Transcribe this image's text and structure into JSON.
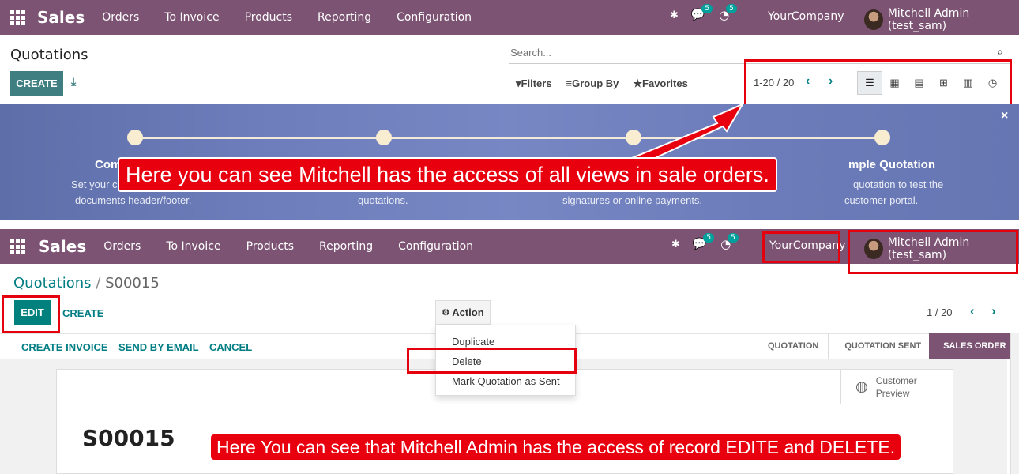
{
  "top_nav": {
    "brand": "Sales",
    "menu": [
      "Orders",
      "To Invoice",
      "Products",
      "Reporting",
      "Configuration"
    ],
    "chat_badge": "5",
    "activity_badge": "5",
    "company": "YourCompany",
    "user": "Mitchell Admin (test_sam)"
  },
  "list_view": {
    "title": "Quotations",
    "create_label": "CREATE",
    "search_placeholder": "Search...",
    "filters_label": "Filters",
    "group_by_label": "Group By",
    "favorites_label": "Favorites",
    "pager": "1-20 / 20",
    "view_icons": [
      "list-view-icon",
      "kanban-view-icon",
      "calendar-view-icon",
      "pivot-view-icon",
      "graph-view-icon",
      "activity-view-icon"
    ]
  },
  "banner": {
    "step1_title": "Com",
    "step1_text_a": "Set your c",
    "step1_text_b": "documents header/footer.",
    "step2_text": "quotations.",
    "step3_text": "signatures or online payments.",
    "step4_title": "mple Quotation",
    "step4_text_a": "quotation to test the",
    "step4_text_b": "customer portal.",
    "close": "×"
  },
  "callout_top": "Here you can see Mitchell has the access of all views in sale orders.",
  "form_view": {
    "breadcrumb_parent": "Quotations",
    "breadcrumb_sep": "/",
    "breadcrumb_current": "S00015",
    "edit_label": "EDIT",
    "create_label": "CREATE",
    "action_label": "Action",
    "action_menu": [
      "Duplicate",
      "Delete",
      "Mark Quotation as Sent"
    ],
    "pager": "1 / 20",
    "header_buttons": [
      "CREATE INVOICE",
      "SEND BY EMAIL",
      "CANCEL"
    ],
    "status_steps": [
      "QUOTATION",
      "QUOTATION SENT",
      "SALES ORDER"
    ],
    "customer_preview_line1": "Customer",
    "customer_preview_line2": "Preview",
    "record_name": "S00015"
  },
  "callout_bottom": "Here You can see that Mitchell Admin has the access of record EDITE and DELETE.",
  "colors": {
    "navbar": "#7c5373",
    "primary": "#00817e",
    "callout": "#e8000e"
  }
}
